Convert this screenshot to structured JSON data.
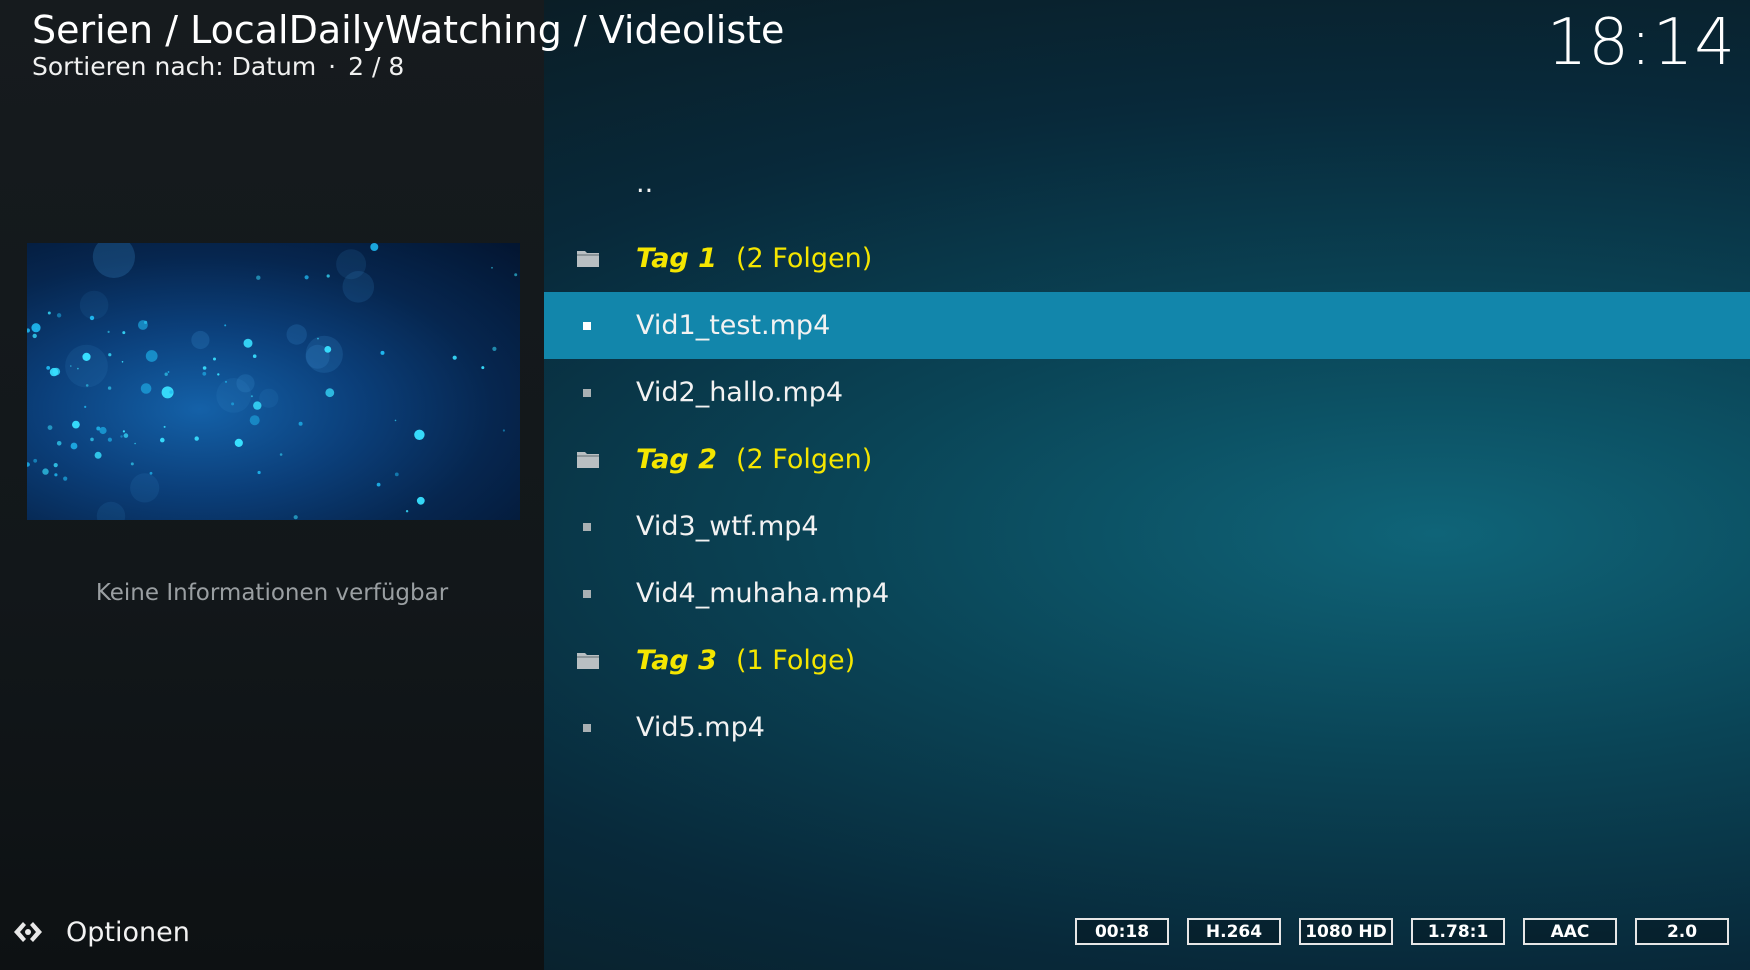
{
  "header": {
    "breadcrumb": "Serien / LocalDailyWatching / Videoliste",
    "sort_label": "Sortieren nach: Datum",
    "separator": "·",
    "position": "2 / 8"
  },
  "clock": "18:14",
  "left_panel": {
    "no_info": "Keine Informationen verfügbar",
    "options_label": "Optionen"
  },
  "list": {
    "parent": "..",
    "items": [
      {
        "type": "group",
        "label": "Tag 1",
        "count": "(2 Folgen)"
      },
      {
        "type": "video",
        "label": "Vid1_test.mp4",
        "selected": true
      },
      {
        "type": "video",
        "label": "Vid2_hallo.mp4"
      },
      {
        "type": "group",
        "label": "Tag 2",
        "count": "(2 Folgen)"
      },
      {
        "type": "video",
        "label": "Vid3_wtf.mp4"
      },
      {
        "type": "video",
        "label": "Vid4_muhaha.mp4"
      },
      {
        "type": "group",
        "label": "Tag 3",
        "count": "(1 Folge)"
      },
      {
        "type": "video",
        "label": "Vid5.mp4"
      }
    ]
  },
  "flags": [
    "00:18",
    "H.264",
    "1080 HD",
    "1.78:1",
    "AAC",
    "2.0"
  ],
  "colors": {
    "accent": "#1286ab",
    "group_text": "#f5e600"
  }
}
